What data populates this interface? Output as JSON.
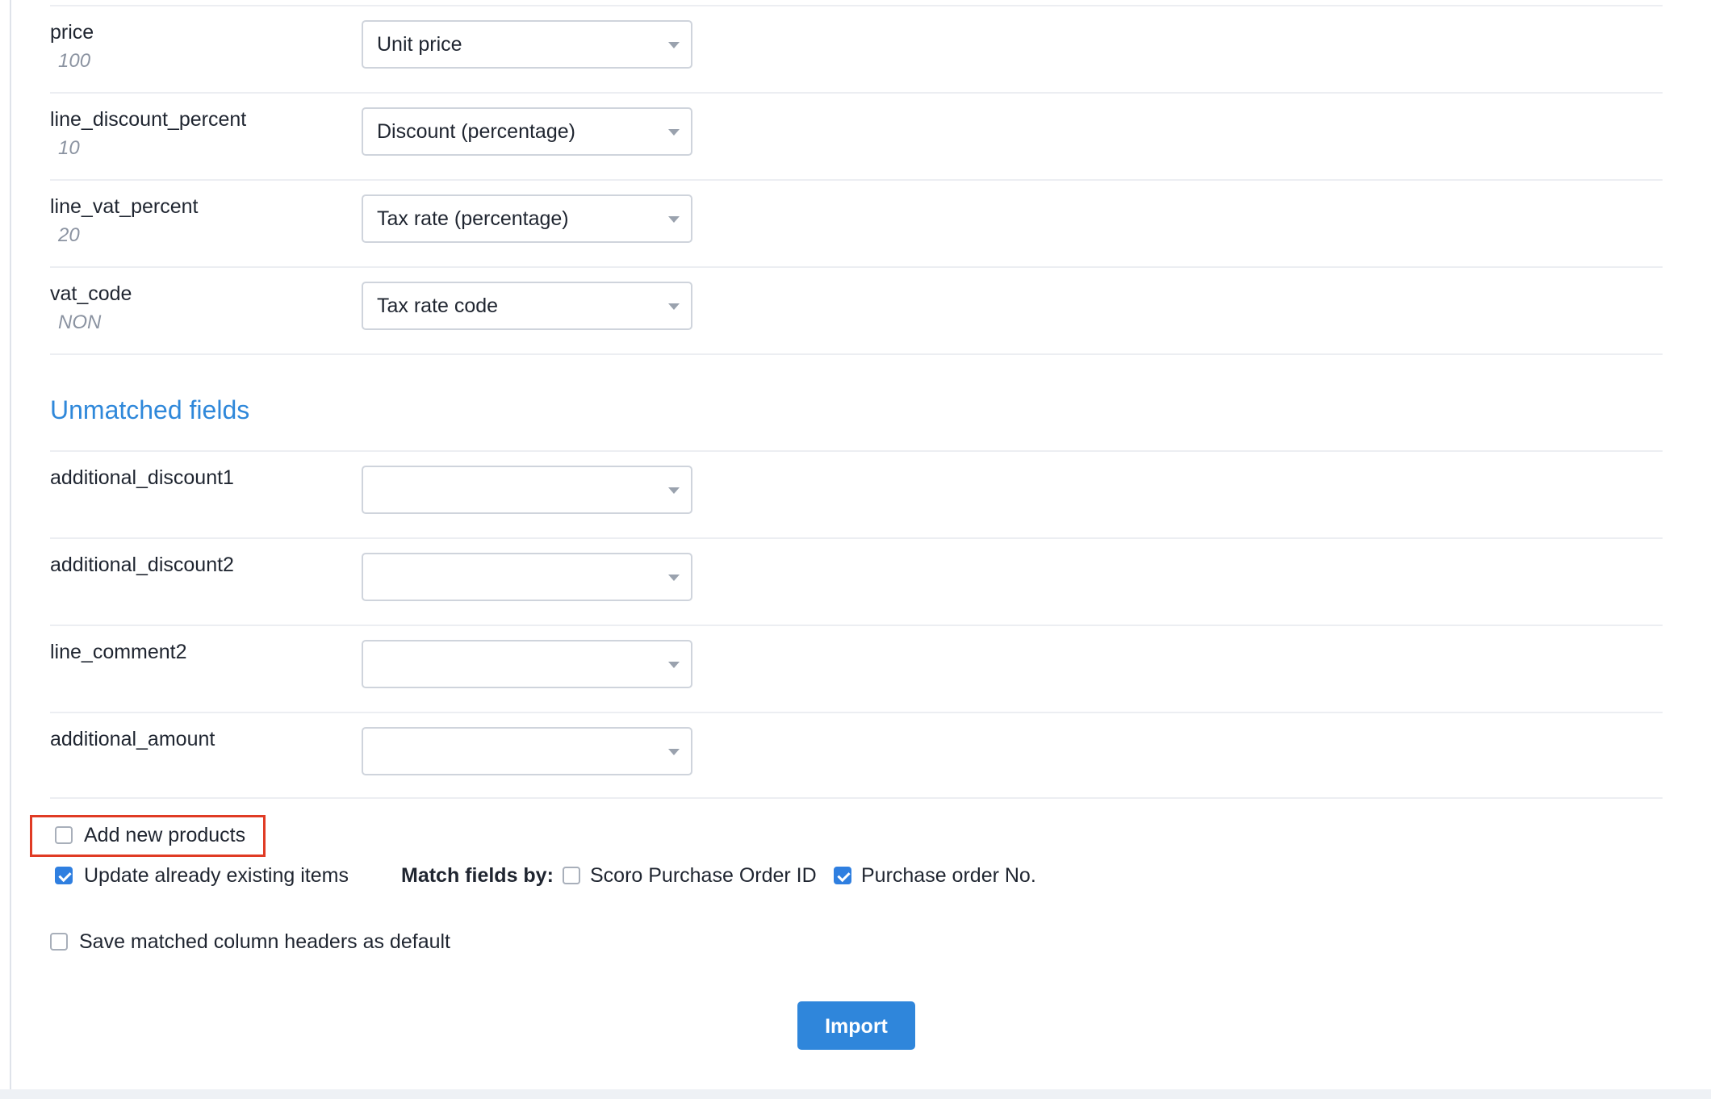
{
  "matched_fields": [
    {
      "name": "price",
      "sample": "100",
      "selected": "Unit price"
    },
    {
      "name": "line_discount_percent",
      "sample": "10",
      "selected": "Discount (percentage)"
    },
    {
      "name": "line_vat_percent",
      "sample": "20",
      "selected": "Tax rate (percentage)"
    },
    {
      "name": "vat_code",
      "sample": "NON",
      "selected": "Tax rate code"
    }
  ],
  "unmatched_section": {
    "title": "Unmatched fields",
    "fields": [
      {
        "name": "additional_discount1",
        "selected": ""
      },
      {
        "name": "additional_discount2",
        "selected": ""
      },
      {
        "name": "line_comment2",
        "selected": ""
      },
      {
        "name": "additional_amount",
        "selected": ""
      }
    ]
  },
  "options": {
    "add_new_products": {
      "label": "Add new products",
      "checked": false
    },
    "update_existing": {
      "label": "Update already existing items",
      "checked": true
    },
    "match_fields_by": {
      "label": "Match fields by:",
      "scoro_po_id": {
        "label": "Scoro Purchase Order ID",
        "checked": false
      },
      "po_number": {
        "label": "Purchase order No.",
        "checked": true
      }
    },
    "save_headers": {
      "label": "Save matched column headers as default",
      "checked": false
    }
  },
  "import_button": {
    "label": "Import"
  },
  "colors": {
    "accent": "#2f86db",
    "highlight": "#e03b24"
  }
}
